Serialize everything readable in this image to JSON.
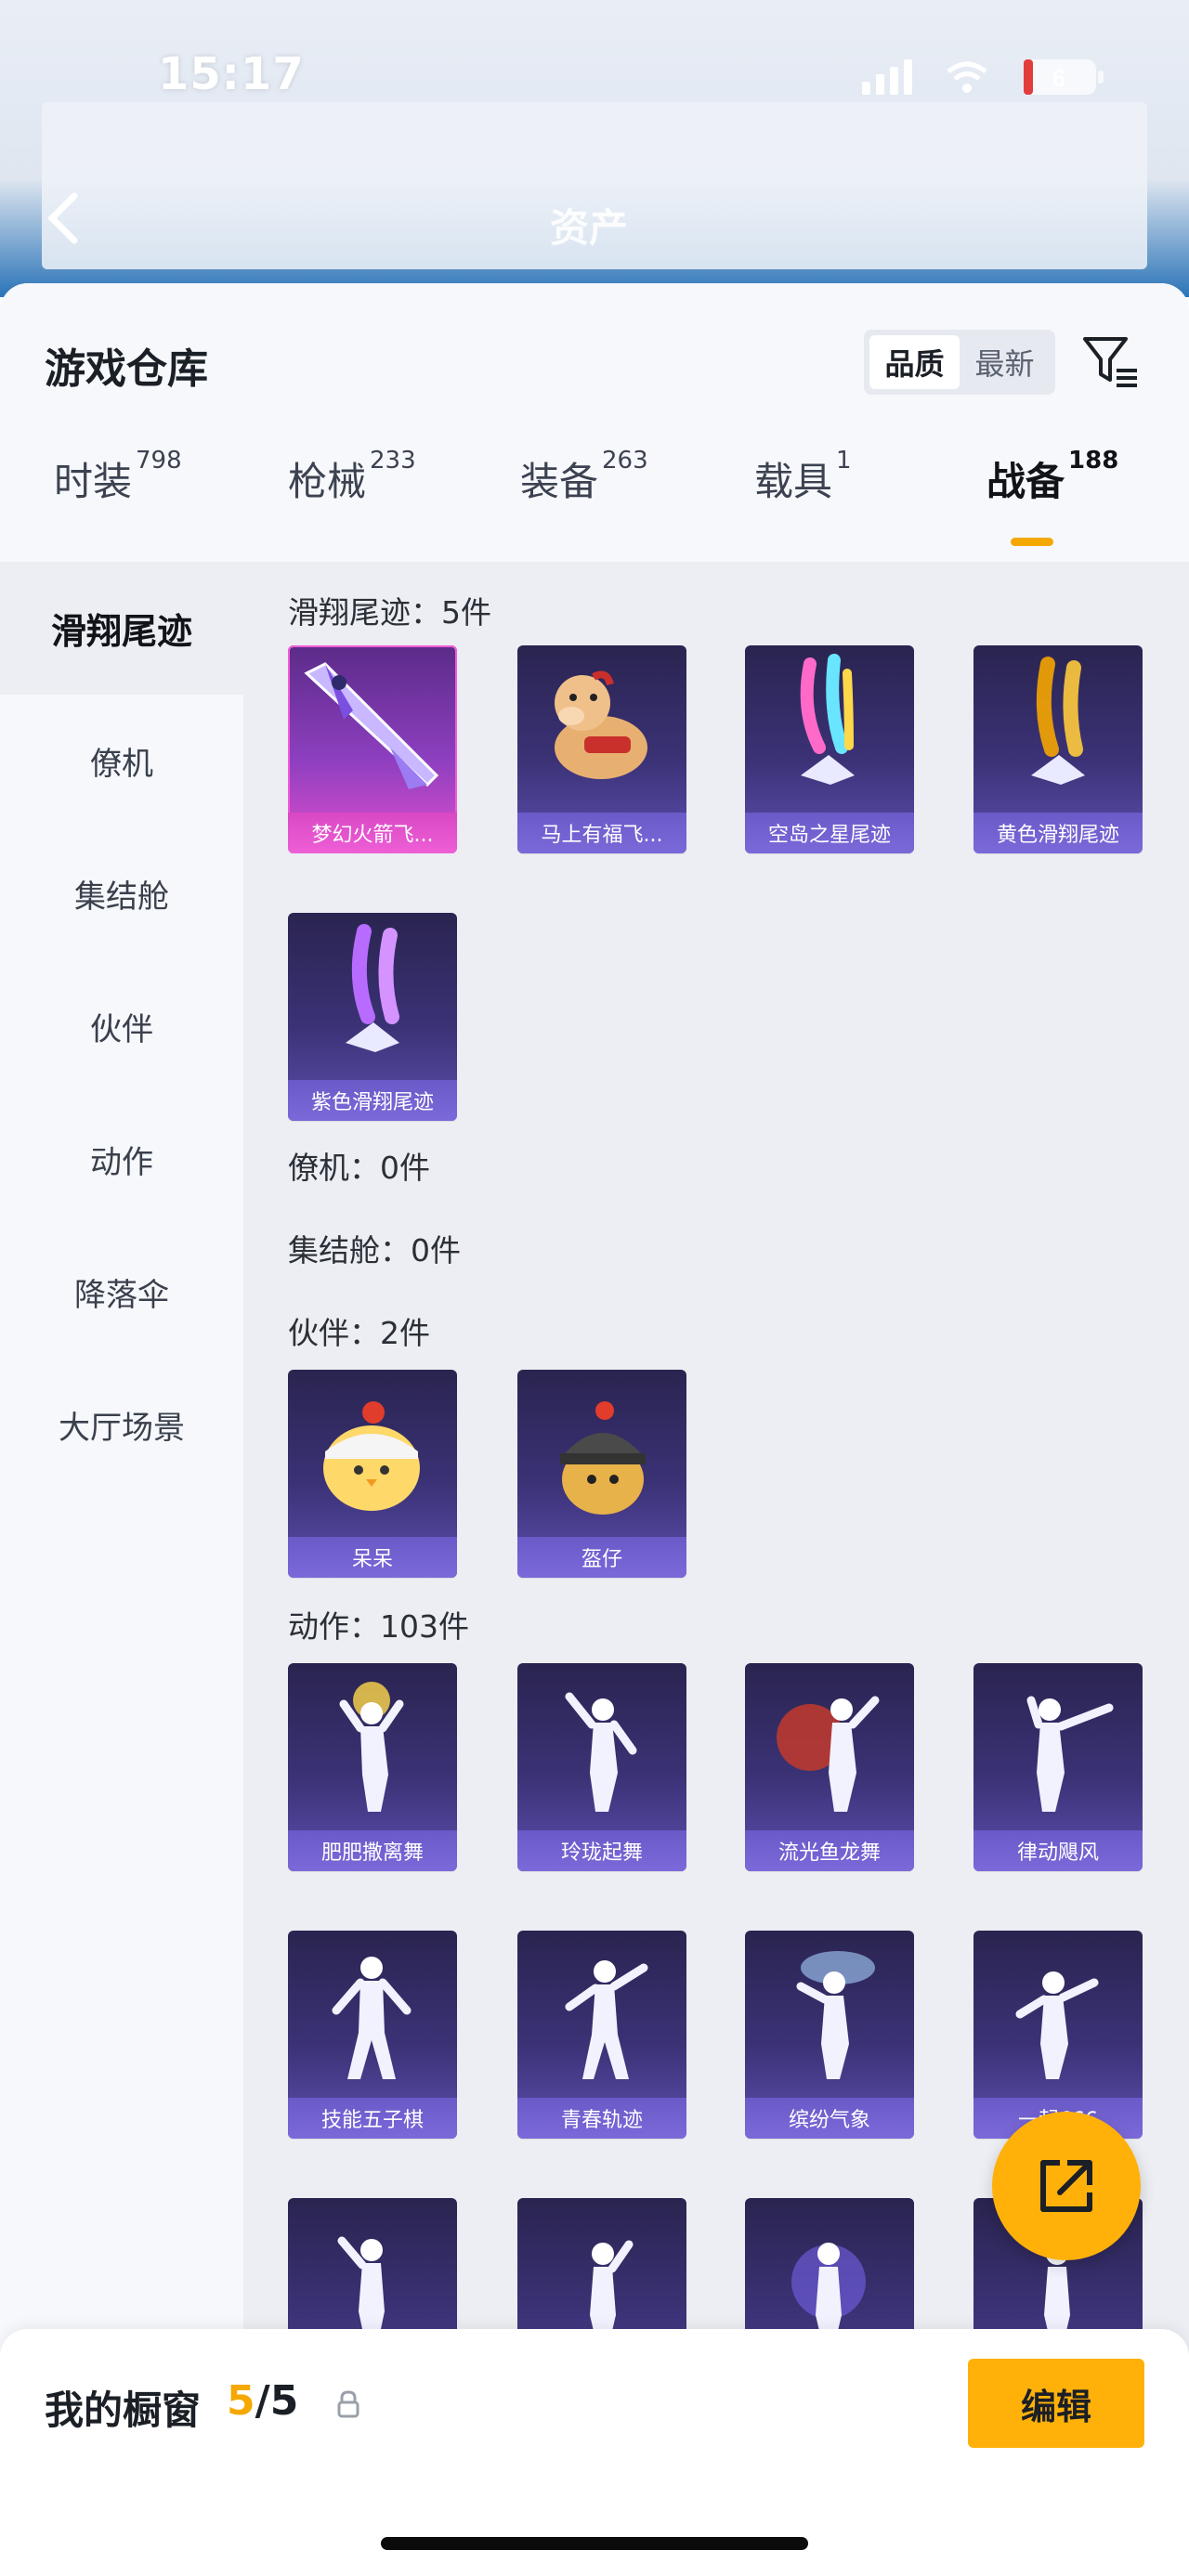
{
  "status_bar": {
    "time": "15:17",
    "battery": "6"
  },
  "background_header": {
    "title": "资产"
  },
  "sheet": {
    "title": "游戏仓库",
    "sort": {
      "options": [
        "品质",
        "最新"
      ],
      "selected": "品质"
    }
  },
  "tabs": [
    {
      "label": "时装",
      "count": "798"
    },
    {
      "label": "枪械",
      "count": "233"
    },
    {
      "label": "装备",
      "count": "263"
    },
    {
      "label": "载具",
      "count": "1"
    },
    {
      "label": "战备",
      "count": "188",
      "active": true
    }
  ],
  "sidebar": [
    {
      "label": "滑翔尾迹",
      "active": true
    },
    {
      "label": "僚机"
    },
    {
      "label": "集结舱"
    },
    {
      "label": "伙伴"
    },
    {
      "label": "动作"
    },
    {
      "label": "降落伞"
    },
    {
      "label": "大厅场景"
    }
  ],
  "sections": {
    "trail": {
      "title": "滑翔尾迹：5件",
      "items": [
        "梦幻火箭飞...",
        "马上有福飞...",
        "空岛之星尾迹",
        "黄色滑翔尾迹",
        "紫色滑翔尾迹"
      ]
    },
    "wingman": {
      "title": "僚机：0件"
    },
    "pod": {
      "title": "集结舱：0件"
    },
    "partner": {
      "title": "伙伴：2件",
      "items": [
        "呆呆",
        "盔仔"
      ]
    },
    "emote": {
      "title": "动作：103件",
      "items": [
        "肥肥撒离舞",
        "玲珑起舞",
        "流光鱼龙舞",
        "律动飓风",
        "技能五子棋",
        "青春轨迹",
        "缤纷气象",
        "一起666"
      ]
    }
  },
  "bottom_bar": {
    "label": "我的橱窗",
    "count_current": "5",
    "count_separator": "/",
    "count_max": "5",
    "edit_label": "编辑"
  },
  "colors": {
    "accent": "#ffb10a",
    "card_bg": "#3b3276",
    "legendary": "#e34fcd"
  }
}
